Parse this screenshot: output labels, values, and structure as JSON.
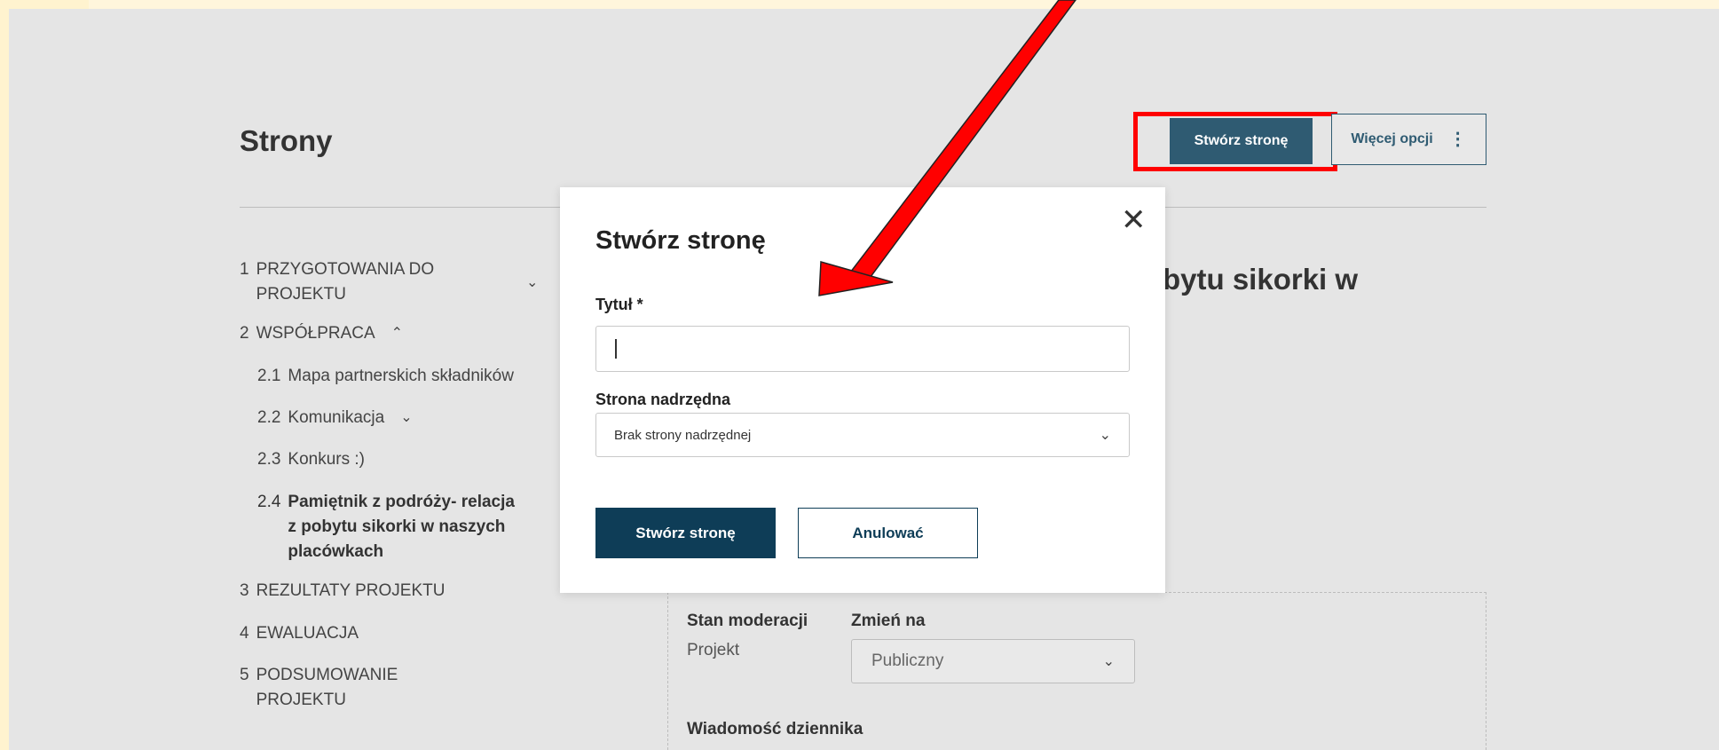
{
  "header": {
    "title": "Strony",
    "create_button": "Stwórz stronę",
    "more_button": "Więcej opcji",
    "more_icon": "kebab-icon"
  },
  "nav": {
    "items": [
      {
        "num": "1",
        "label": "PRZYGOTOWANIA DO\nPROJEKTU",
        "chevron": "chevron-down"
      },
      {
        "num": "2",
        "label": "WSPÓŁPRACA",
        "chevron": "chevron-up"
      },
      {
        "num": "2.1",
        "label": "Mapa partnerskich składników"
      },
      {
        "num": "2.2",
        "label": "Komunikacja",
        "chevron": "chevron-down"
      },
      {
        "num": "2.3",
        "label": "Konkurs :)"
      },
      {
        "num": "2.4",
        "label": "Pamiętnik z podróży- relacja\nz pobytu sikorki w naszych\nplacówkach",
        "active": true
      },
      {
        "num": "3",
        "label": "REZULTATY PROJEKTU"
      },
      {
        "num": "4",
        "label": "EWALUACJA"
      },
      {
        "num": "5",
        "label": "PODSUMOWANIE\nPROJEKTU"
      }
    ]
  },
  "background": {
    "heading_fragment": "bytu sikorki w"
  },
  "moderation": {
    "state_label": "Stan moderacji",
    "state_value": "Projekt",
    "change_label": "Zmień na",
    "change_value": "Publiczny",
    "log_label": "Wiadomość dziennika"
  },
  "modal": {
    "title": "Stwórz stronę",
    "title_label": "Tytuł *",
    "title_value": "",
    "parent_label": "Strona nadrzędna",
    "parent_value": "Brak strony nadrzędnej",
    "create_button": "Stwórz stronę",
    "cancel_button": "Anulować",
    "close_icon": "close-icon"
  },
  "annotation": {
    "arrow_color": "#ff0000",
    "highlight_color": "#ff0000"
  }
}
